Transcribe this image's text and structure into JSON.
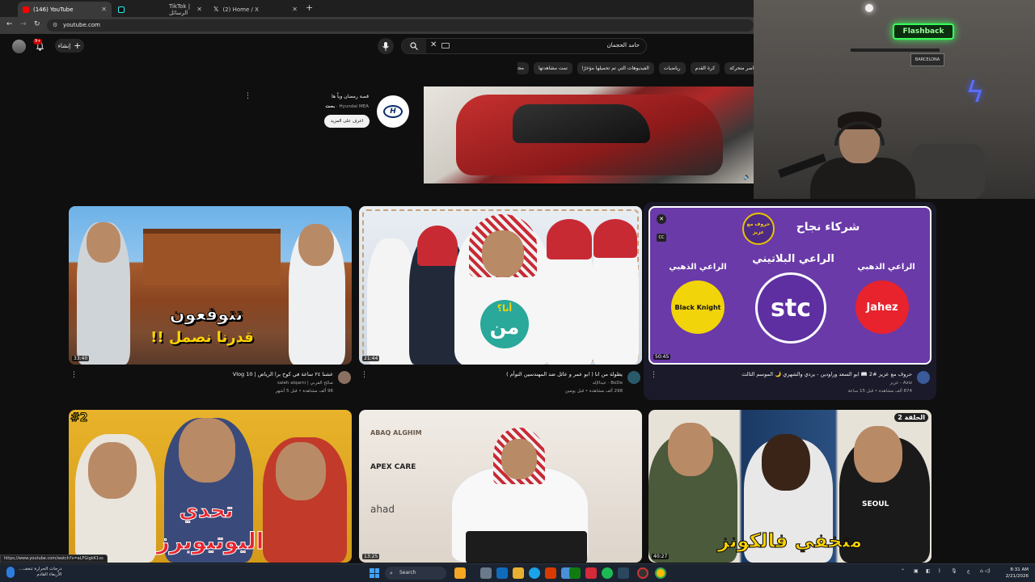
{
  "browser": {
    "tabs": [
      {
        "label": "(146) YouTube",
        "active": true,
        "icon": "youtube-favicon"
      },
      {
        "label": "TikTok | الرسائل",
        "active": false,
        "icon": "tiktok-favicon"
      },
      {
        "label": "(2) Home / X",
        "active": false,
        "icon": "x-favicon"
      }
    ],
    "url": "youtube.com",
    "status_url": "https://www.youtube.com/watch?v=aLFGigkK1vs"
  },
  "youtube": {
    "notification_count": "9+",
    "create_label": "إنشاء",
    "search_value": "حامد الحجمان",
    "chips": [
      "عناصر متحركة",
      "كرة القدم",
      "رياضيات",
      "الفيديوهات التي تم تحميلها مؤخرًا",
      "تمت مشاهدتها",
      "محتوى جديد لك"
    ]
  },
  "ad": {
    "title": "قصة رمضان وياً ها",
    "sponsor_label": "بحث",
    "advertiser": "Hyundai MEA",
    "cta_label": "اعرف على المزيد",
    "logo_text": "HYUNDAI"
  },
  "webcam": {
    "neon_text": "Flashback",
    "poster_text": "BARCELONA"
  },
  "videos": [
    {
      "title": "عشنا ٢٤ ساعة في كوخ برا الرياض | Vlog 10",
      "channel": "صالح القرني | saleh alqarni",
      "meta": "96 ألف مشاهدة • قبل 5 أشهر",
      "duration": "33:40",
      "thumb_line1": "تتوقعون",
      "thumb_line2": "قدرنا نصمل !!"
    },
    {
      "title": "يطولة من انا ( ابو عمر و عائل ضد المهندسين التوأم )",
      "channel": "BoDe · عبدالإله",
      "meta": "298 ألف مشاهدة • قبل يومين",
      "duration": "21:44",
      "thumb_badge": "من",
      "thumb_badge_top": "أنا؟"
    },
    {
      "title": "حروف مع عزيز #2 📖 ابو السعد وراودين - يردي والشهري 🌙 الموسم الثالث",
      "channel": "Aziz - عزيز",
      "meta": "874 ألف مشاهدة • قبل 15 ساعة",
      "duration": "50:45",
      "thumb_header": "شركاء نجاح",
      "thumb_logo": "حروف مع عزيز",
      "sponsor_left_label": "الراعي الذهبي",
      "sponsor_mid_label": "الراعي البلاتيني",
      "sponsor_right_label": "الراعي الذهبي",
      "sponsor_left": "Black Knight",
      "sponsor_mid": "stc",
      "sponsor_right": "Jahez"
    },
    {
      "duration": "",
      "thumb_badge": "#2",
      "thumb_line1": "تحدي",
      "thumb_line2": "اليوتيوبرز"
    },
    {
      "duration": "13:25",
      "thumb_brand1": "ABAQ ALGHIM",
      "thumb_brand2": "APEX CARE",
      "thumb_brand3": "ahad"
    },
    {
      "duration": "40:27",
      "thumb_badge": "الحلقة 2",
      "thumb_line1": "متخفي فالكونز",
      "shirt_text": "SEOUL"
    }
  ],
  "taskbar": {
    "weather_line1": "درجات الحرارة تنخف...",
    "weather_line2": "الأربعاء القادم",
    "search_label": "Search",
    "time": "8:31 AM",
    "date": "2/21/2026"
  },
  "colors": {
    "youtube_red": "#ff0000",
    "tiktok": "#000000",
    "stc_purple": "#6a3aa8",
    "jahez_red": "#e8232d",
    "neon_green": "#39ff5a"
  }
}
